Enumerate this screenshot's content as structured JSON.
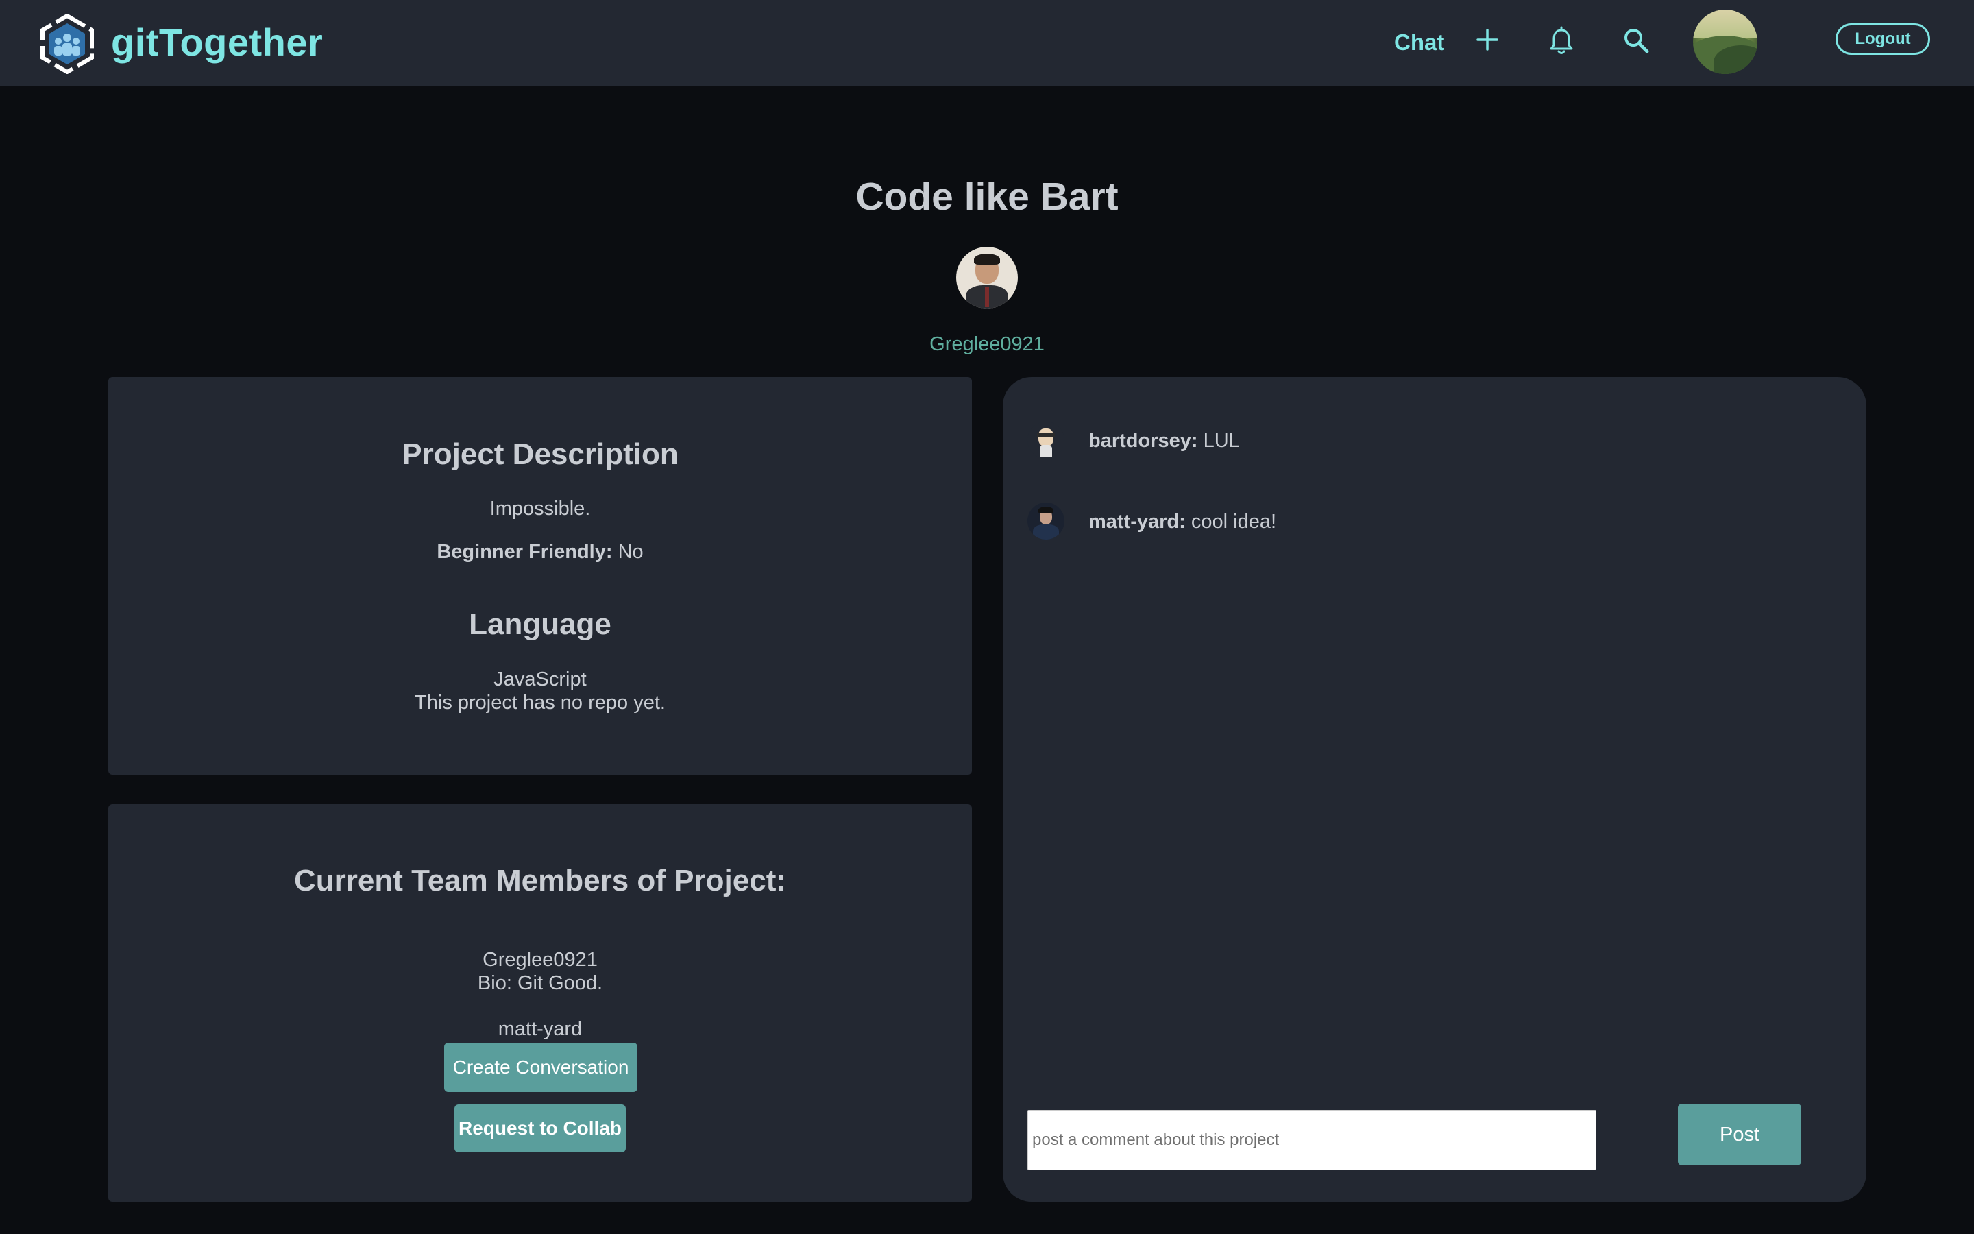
{
  "navbar": {
    "brand": "gitTogether",
    "chat_label": "Chat",
    "logout_label": "Logout"
  },
  "project": {
    "title": "Code like Bart",
    "owner": "Greglee0921"
  },
  "description_card": {
    "heading": "Project Description",
    "description": "Impossible.",
    "beginner_label": "Beginner Friendly:",
    "beginner_value": "No",
    "language_heading": "Language",
    "language": "JavaScript",
    "repo_text": "This project has no repo yet."
  },
  "team_card": {
    "heading": "Current Team Members of Project:",
    "members": [
      {
        "name": "Greglee0921",
        "bio": "Bio: Git Good."
      },
      {
        "name": "matt-yard"
      }
    ],
    "create_conversation_label": "Create Conversation",
    "request_collab_label": "Request to Collab"
  },
  "comments": {
    "items": [
      {
        "user": "bartdorsey:",
        "text": "LUL"
      },
      {
        "user": "matt-yard:",
        "text": "cool idea!"
      }
    ],
    "input_placeholder": "post a comment about this project",
    "post_label": "Post"
  },
  "colors": {
    "accent": "#7ee5e3",
    "button": "#5a9e9c",
    "card": "#232832",
    "background": "#0b0d11"
  },
  "icons": [
    "logo-icon",
    "plus-icon",
    "bell-icon",
    "search-icon"
  ]
}
